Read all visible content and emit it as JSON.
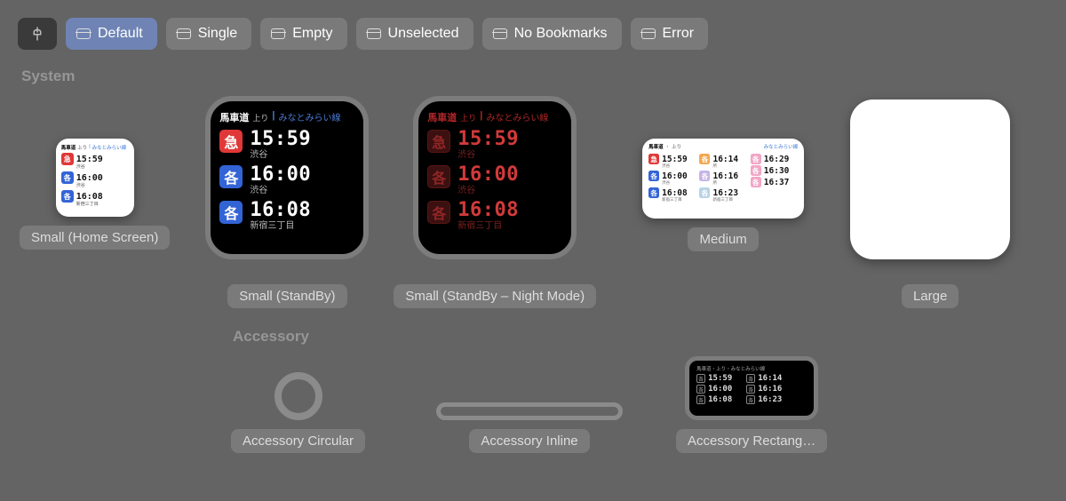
{
  "toolbar": {
    "pills": [
      {
        "label": "Default",
        "active": true
      },
      {
        "label": "Single",
        "active": false
      },
      {
        "label": "Empty",
        "active": false
      },
      {
        "label": "Unselected",
        "active": false
      },
      {
        "label": "No Bookmarks",
        "active": false
      },
      {
        "label": "Error",
        "active": false
      }
    ]
  },
  "sections": {
    "system": "System",
    "accessory": "Accessory"
  },
  "captions": {
    "small_home": "Small (Home Screen)",
    "small_standby": "Small (StandBy)",
    "small_standby_night": "Small (StandBy – Night Mode)",
    "medium": "Medium",
    "large": "Large",
    "acc_circular": "Accessory Circular",
    "acc_inline": "Accessory Inline",
    "acc_rect": "Accessory Rectang…"
  },
  "widget_header": {
    "station": "馬車道",
    "direction": "上り",
    "line": "みなとみらい線"
  },
  "small_home_rows": [
    {
      "tag": "急",
      "color": "red",
      "time": "15:59",
      "dest": "渋谷"
    },
    {
      "tag": "各",
      "color": "blue",
      "time": "16:00",
      "dest": "渋谷"
    },
    {
      "tag": "各",
      "color": "blue",
      "time": "16:08",
      "dest": "新宿三丁目"
    }
  ],
  "standby_rows": [
    {
      "tag": "急",
      "color": "red",
      "time": "15:59",
      "dest": "渋谷"
    },
    {
      "tag": "各",
      "color": "blue",
      "time": "16:00",
      "dest": "渋谷"
    },
    {
      "tag": "各",
      "color": "blue",
      "time": "16:08",
      "dest": "新宿三丁目"
    }
  ],
  "medium_cols": [
    [
      {
        "tag": "急",
        "color": "red",
        "time": "15:59",
        "dest": "渋谷"
      },
      {
        "tag": "各",
        "color": "blue",
        "time": "16:00",
        "dest": "渋谷"
      },
      {
        "tag": "各",
        "color": "blue",
        "time": "16:08",
        "dest": "新宿三丁目"
      }
    ],
    [
      {
        "tag": "各",
        "color": "orange",
        "time": "16:14",
        "dest": "所"
      },
      {
        "tag": "各",
        "color": "lav",
        "time": "16:16",
        "dest": "所"
      },
      {
        "tag": "各",
        "color": "sky",
        "time": "16:23",
        "dest": "新宿三丁目"
      }
    ],
    [
      {
        "tag": "各",
        "color": "pink",
        "time": "16:29",
        "dest": ""
      },
      {
        "tag": "各",
        "color": "pink",
        "time": "16:30",
        "dest": ""
      },
      {
        "tag": "各",
        "color": "pink",
        "time": "16:37",
        "dest": ""
      }
    ]
  ],
  "rect_acc": {
    "header": "馬車道・上り・みなとみらい線",
    "rows": [
      [
        {
          "tag": "各",
          "time": "15:59"
        },
        {
          "tag": "各",
          "time": "16:14"
        }
      ],
      [
        {
          "tag": "各",
          "time": "16:00"
        },
        {
          "tag": "各",
          "time": "16:16"
        }
      ],
      [
        {
          "tag": "各",
          "time": "16:08"
        },
        {
          "tag": "各",
          "time": "16:23"
        }
      ]
    ]
  }
}
